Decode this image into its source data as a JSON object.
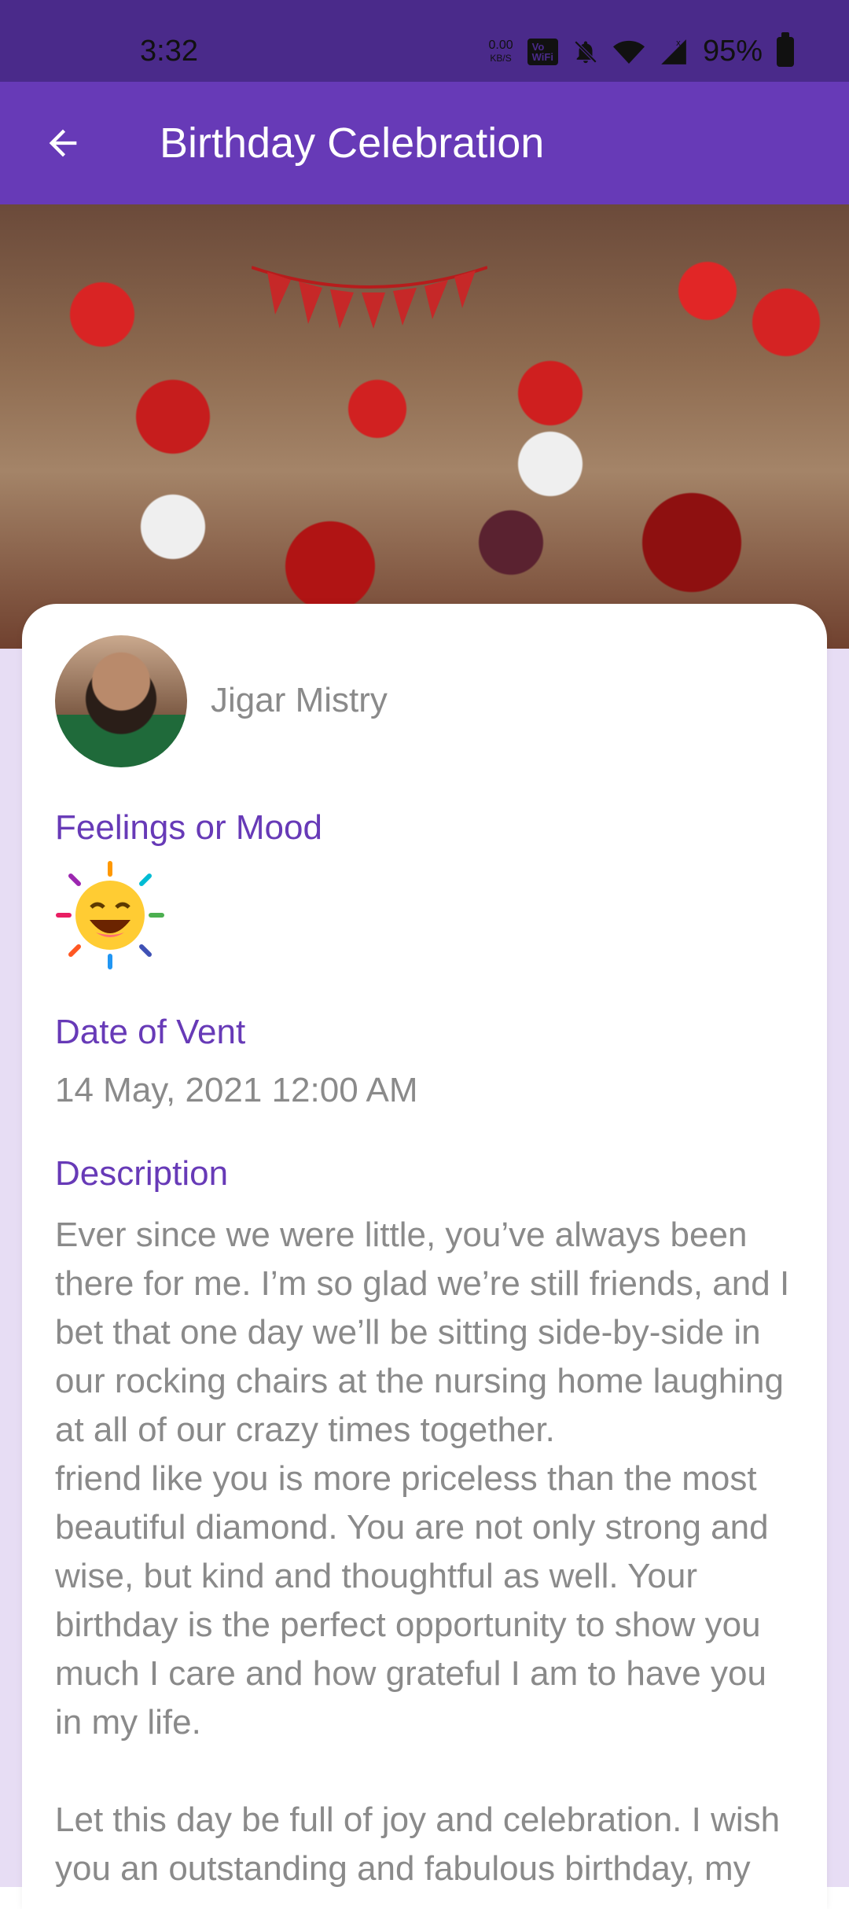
{
  "status_bar": {
    "time": "3:32",
    "net_speed": "0.00",
    "net_unit": "KB/S",
    "volte_top": "Vo",
    "volte_bottom": "WiFi",
    "battery": "95%"
  },
  "app_bar": {
    "title": "Birthday Celebration"
  },
  "post": {
    "author_name": "Jigar Mistry",
    "feelings_label": "Feelings or Mood",
    "date_label": "Date of Vent",
    "date_value": "14 May, 2021 12:00 AM",
    "description_label": "Description",
    "description": "Ever since we were little, you’ve always been there for me. I’m so glad we’re still friends, and I bet that one day we’ll be sitting side-by-side in our rocking chairs at the nursing home laughing at all of our crazy times together.\nfriend like you is more priceless than the most beautiful diamond. You are not only strong and wise, but kind and thoughtful as well. Your birthday is the perfect opportunity to show you much I care and how grateful I am to have you in my life.\n\nLet this day be full of joy and celebration. I wish you an outstanding and fabulous birthday, my"
  },
  "carousel": {
    "active_index": 0,
    "count": 2
  },
  "colors": {
    "primary": "#673ab7",
    "status_bar": "#4a2a8a",
    "content_bg": "#e7ddf4",
    "text_gray": "#8a8a8a"
  }
}
